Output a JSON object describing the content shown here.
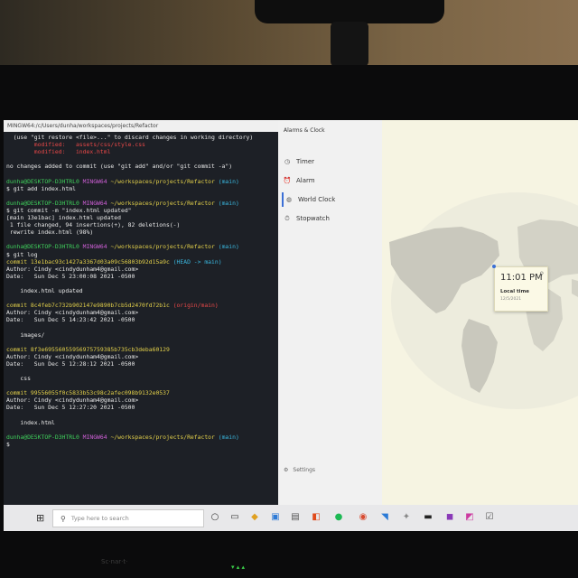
{
  "terminal": {
    "title": "MINGW64:/c/Users/dunha/workspaces/projects/Refactor",
    "lines": [
      [
        {
          "t": "  (use \"git restore <file>...\" to discard changes in working directory)",
          "c": ""
        }
      ],
      [
        {
          "t": "        modified:   ",
          "c": "red"
        },
        {
          "t": "assets/css/style.css",
          "c": "red"
        }
      ],
      [
        {
          "t": "        modified:   ",
          "c": "red"
        },
        {
          "t": "index.html",
          "c": "red"
        }
      ],
      [
        {
          "t": "",
          "c": ""
        }
      ],
      [
        {
          "t": "no changes added to commit (use \"git add\" and/or \"git commit -a\")",
          "c": ""
        }
      ],
      [
        {
          "t": "",
          "c": ""
        }
      ],
      [
        {
          "t": "dunha@DESKTOP-D3HTRL0 ",
          "c": "green"
        },
        {
          "t": "MINGW64 ",
          "c": "purple"
        },
        {
          "t": "~/workspaces/projects/Refactor ",
          "c": "yellow"
        },
        {
          "t": "(main)",
          "c": "cyan"
        }
      ],
      [
        {
          "t": "$ git add index.html",
          "c": ""
        }
      ],
      [
        {
          "t": "",
          "c": ""
        }
      ],
      [
        {
          "t": "dunha@DESKTOP-D3HTRL0 ",
          "c": "green"
        },
        {
          "t": "MINGW64 ",
          "c": "purple"
        },
        {
          "t": "~/workspaces/projects/Refactor ",
          "c": "yellow"
        },
        {
          "t": "(main)",
          "c": "cyan"
        }
      ],
      [
        {
          "t": "$ git commit -m \"index.html updated\"",
          "c": ""
        }
      ],
      [
        {
          "t": "[main 13e1bac] index.html updated",
          "c": ""
        }
      ],
      [
        {
          "t": " 1 file changed, 94 insertions(+), 82 deletions(-)",
          "c": ""
        }
      ],
      [
        {
          "t": " rewrite index.html (98%)",
          "c": ""
        }
      ],
      [
        {
          "t": "",
          "c": ""
        }
      ],
      [
        {
          "t": "dunha@DESKTOP-D3HTRL0 ",
          "c": "green"
        },
        {
          "t": "MINGW64 ",
          "c": "purple"
        },
        {
          "t": "~/workspaces/projects/Refactor ",
          "c": "yellow"
        },
        {
          "t": "(main)",
          "c": "cyan"
        }
      ],
      [
        {
          "t": "$ git log",
          "c": ""
        }
      ],
      [
        {
          "t": "commit 13e1bac93c1427a3367d03a09c56803b92d15a9c ",
          "c": "yellow"
        },
        {
          "t": "(HEAD -> main)",
          "c": "cyan"
        }
      ],
      [
        {
          "t": "Author: Cindy <cindydunham4@gmail.com>",
          "c": ""
        }
      ],
      [
        {
          "t": "Date:   Sun Dec 5 23:00:08 2021 -0500",
          "c": ""
        }
      ],
      [
        {
          "t": "",
          "c": ""
        }
      ],
      [
        {
          "t": "    index.html updated",
          "c": ""
        }
      ],
      [
        {
          "t": "",
          "c": ""
        }
      ],
      [
        {
          "t": "commit 8c4feb7c732b902147e9890b7cb5d2470fd72b1c ",
          "c": "yellow"
        },
        {
          "t": "(origin/main)",
          "c": "red"
        }
      ],
      [
        {
          "t": "Author: Cindy <cindydunham4@gmail.com>",
          "c": ""
        }
      ],
      [
        {
          "t": "Date:   Sun Dec 5 14:23:42 2021 -0500",
          "c": ""
        }
      ],
      [
        {
          "t": "",
          "c": ""
        }
      ],
      [
        {
          "t": "    images/",
          "c": ""
        }
      ],
      [
        {
          "t": "",
          "c": ""
        }
      ],
      [
        {
          "t": "commit 8f3e69556055956975759385b735cb3deba60129",
          "c": "yellow"
        }
      ],
      [
        {
          "t": "Author: Cindy <cindydunham4@gmail.com>",
          "c": ""
        }
      ],
      [
        {
          "t": "Date:   Sun Dec 5 12:28:12 2021 -0500",
          "c": ""
        }
      ],
      [
        {
          "t": "",
          "c": ""
        }
      ],
      [
        {
          "t": "    css",
          "c": ""
        }
      ],
      [
        {
          "t": "",
          "c": ""
        }
      ],
      [
        {
          "t": "commit 99556055f0c5833b53c98c2afec098b9132e0537",
          "c": "yellow"
        }
      ],
      [
        {
          "t": "Author: Cindy <cindydunham4@gmail.com>",
          "c": ""
        }
      ],
      [
        {
          "t": "Date:   Sun Dec 5 12:27:20 2021 -0500",
          "c": ""
        }
      ],
      [
        {
          "t": "",
          "c": ""
        }
      ],
      [
        {
          "t": "    index.html",
          "c": ""
        }
      ],
      [
        {
          "t": "",
          "c": ""
        }
      ],
      [
        {
          "t": "dunha@DESKTOP-D3HTRL0 ",
          "c": "green"
        },
        {
          "t": "MINGW64 ",
          "c": "purple"
        },
        {
          "t": "~/workspaces/projects/Refactor ",
          "c": "yellow"
        },
        {
          "t": "(main)",
          "c": "cyan"
        }
      ],
      [
        {
          "t": "$",
          "c": ""
        }
      ]
    ]
  },
  "alarms": {
    "title": "Alarms & Clock",
    "nav": [
      {
        "label": "Timer",
        "icon": "timer-icon",
        "glyph": "◷",
        "active": false
      },
      {
        "label": "Alarm",
        "icon": "alarm-icon",
        "glyph": "⏰",
        "active": false
      },
      {
        "label": "World Clock",
        "icon": "globe-icon",
        "glyph": "◍",
        "active": true
      },
      {
        "label": "Stopwatch",
        "icon": "stopwatch-icon",
        "glyph": "⏱",
        "active": false
      }
    ],
    "settings": "Settings",
    "clock": {
      "time": "11:01 PM",
      "label": "Local time",
      "date": "12/5/2021"
    }
  },
  "taskbar": {
    "search_placeholder": "Type here to search",
    "icons": [
      {
        "name": "task-view-icon",
        "glyph": "○",
        "color": "#333"
      },
      {
        "name": "file-explorer-icon",
        "glyph": "▭",
        "color": "#333"
      },
      {
        "name": "photos-icon",
        "glyph": "◆",
        "color": "#e0a020"
      },
      {
        "name": "mail-icon",
        "glyph": "▣",
        "color": "#2d7ad6"
      },
      {
        "name": "store-icon",
        "glyph": "▤",
        "color": "#555"
      },
      {
        "name": "office-icon",
        "glyph": "◧",
        "color": "#e04a1a"
      },
      {
        "name": "spotify-icon",
        "glyph": "●",
        "color": "#1db954"
      },
      {
        "name": "chrome-icon",
        "glyph": "◉",
        "color": "#d84a30"
      },
      {
        "name": "vscode-icon",
        "glyph": "◥",
        "color": "#2a7ad6"
      },
      {
        "name": "app-icon",
        "glyph": "✦",
        "color": "#888"
      },
      {
        "name": "terminal-icon",
        "glyph": "▬",
        "color": "#222"
      },
      {
        "name": "onenote-icon",
        "glyph": "◼",
        "color": "#8a3ab8"
      },
      {
        "name": "sticky-notes-icon",
        "glyph": "◩",
        "color": "#cc3aa0"
      },
      {
        "name": "todo-icon",
        "glyph": "☑",
        "color": "#555"
      }
    ]
  },
  "below_monitor_text": "Sc·nar·t·"
}
